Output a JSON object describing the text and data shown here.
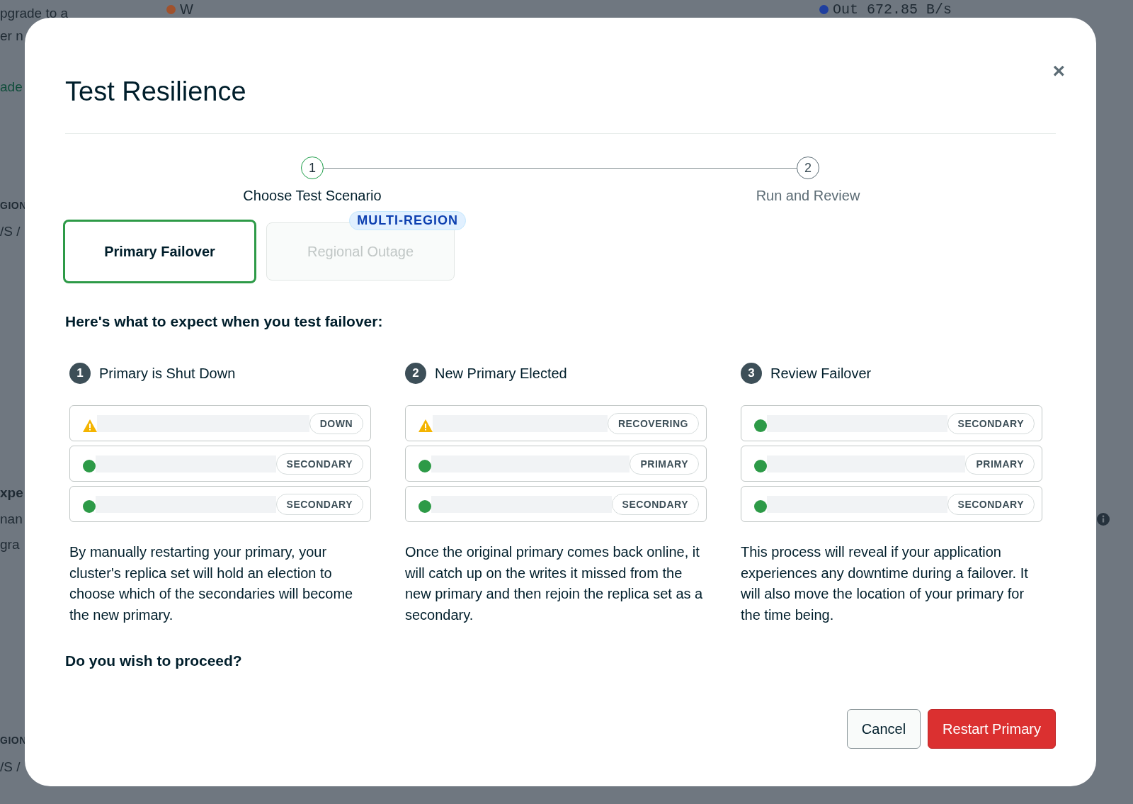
{
  "background": {
    "texts": [
      {
        "kind": "plain",
        "text": "pgrade to a"
      },
      {
        "kind": "plain",
        "text": "er n"
      },
      {
        "kind": "link",
        "text": "ade"
      },
      {
        "kind": "caps",
        "text": "GION"
      },
      {
        "kind": "plain",
        "text": "/S /"
      },
      {
        "kind": "bold",
        "text": "xpe"
      },
      {
        "kind": "plain",
        "text": "nan"
      },
      {
        "kind": "plain",
        "text": "gra"
      },
      {
        "kind": "caps",
        "text": "GION"
      },
      {
        "kind": "plain",
        "text": "/S /"
      }
    ],
    "legend": [
      {
        "label": "W",
        "color": "#a0522d"
      },
      {
        "label": "Out 672.85 B/s",
        "color": "#1f3f9f"
      }
    ]
  },
  "modal": {
    "title": "Test Resilience",
    "close": "×",
    "steps": [
      {
        "number": "1",
        "label": "Choose Test Scenario",
        "selected": true
      },
      {
        "number": "2",
        "label": "Run and Review",
        "selected": false
      }
    ],
    "scenarios": [
      {
        "label": "Primary Failover",
        "selected": true,
        "disabled": false
      },
      {
        "label": "Regional Outage",
        "selected": false,
        "disabled": true,
        "badge": "MULTI-REGION"
      }
    ],
    "heading": "Here's what to expect when you test failover:",
    "phases": [
      {
        "number": "1",
        "title": "Primary is Shut Down",
        "nodes": [
          {
            "kind": "warning",
            "status": "DOWN"
          },
          {
            "kind": "healthy",
            "status": "SECONDARY"
          },
          {
            "kind": "healthy",
            "status": "SECONDARY"
          }
        ],
        "text": "By manually restarting your primary, your cluster's replica set will hold an election to choose which of the secondaries will become the new primary."
      },
      {
        "number": "2",
        "title": "New Primary Elected",
        "nodes": [
          {
            "kind": "warning",
            "status": "RECOVERING"
          },
          {
            "kind": "healthy",
            "status": "PRIMARY"
          },
          {
            "kind": "healthy",
            "status": "SECONDARY"
          }
        ],
        "text": "Once the original primary comes back online, it will catch up on the writes it missed from the new primary and then rejoin the replica set as a secondary."
      },
      {
        "number": "3",
        "title": "Review Failover",
        "nodes": [
          {
            "kind": "healthy",
            "status": "SECONDARY"
          },
          {
            "kind": "healthy",
            "status": "PRIMARY"
          },
          {
            "kind": "healthy",
            "status": "SECONDARY"
          }
        ],
        "text": "This process will reveal if your application experiences any downtime during a failover. It will also move the location of your primary for the time being."
      }
    ],
    "question": "Do you wish to proceed?",
    "buttons": [
      {
        "kind": "secondary",
        "label": "Cancel"
      },
      {
        "kind": "danger",
        "label": "Restart Primary"
      }
    ]
  }
}
